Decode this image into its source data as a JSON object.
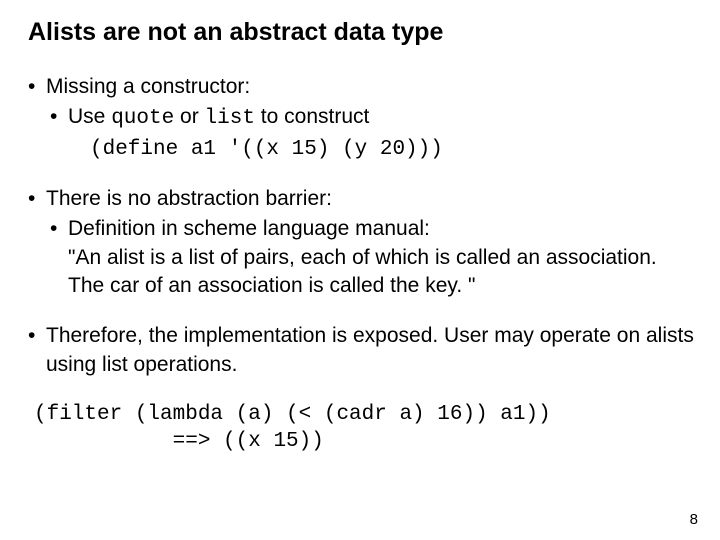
{
  "title": "Alists are not an abstract data type",
  "bullets": [
    {
      "text": "Missing a constructor:",
      "sub": [
        {
          "pre": "Use ",
          "code1": "quote",
          "mid": " or ",
          "code2": "list",
          "post": " to construct"
        }
      ],
      "code": "(define a1 '((x 15) (y 20)))"
    },
    {
      "text": "There is no abstraction barrier:",
      "sub": [
        {
          "plain": "Definition in scheme language manual:"
        }
      ],
      "quote": "\"An alist is a list of pairs, each of which is called an association. The car of an association is called the key. \""
    },
    {
      "text": "Therefore, the implementation is exposed. User may operate on alists using list operations."
    }
  ],
  "bottom_code": "(filter (lambda (a) (< (cadr a) 16)) a1))\n           ==> ((x 15))",
  "page_number": "8"
}
